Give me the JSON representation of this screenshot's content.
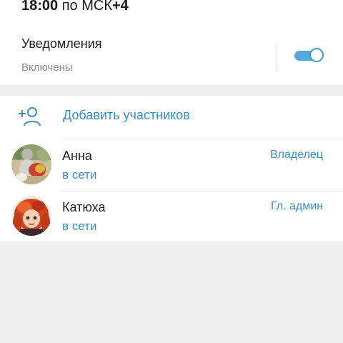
{
  "header": {
    "time": "18:00",
    "timezone": "по МСК",
    "offset": "+4"
  },
  "notifications": {
    "title": "Уведомления",
    "status": "Включены",
    "enabled": true
  },
  "members": {
    "add_label": "Добавить участников",
    "list": [
      {
        "name": "Анна",
        "status": "в сети",
        "role": "Владелец"
      },
      {
        "name": "Катюха",
        "status": "в сети",
        "role": "Гл. админ"
      }
    ]
  },
  "colors": {
    "accent": "#3a8fc8",
    "toggle": "#55a8dd",
    "background": "#efeff0"
  }
}
